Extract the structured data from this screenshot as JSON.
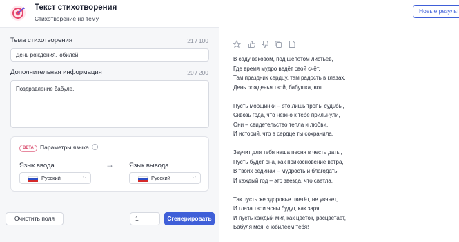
{
  "header": {
    "title": "Текст стихотворения",
    "subtitle": "Стихотворение на тему"
  },
  "topic": {
    "label": "Тема стихотворения",
    "counter": "21 / 100",
    "value": "День рождения, юбилей"
  },
  "extra": {
    "label": "Дополнительная информация",
    "counter": "20 / 200",
    "value": "Поздравление бабуле,"
  },
  "language": {
    "beta": "BETA",
    "title": "Параметры языка",
    "info": "i",
    "input_label": "Язык ввода",
    "output_label": "Язык вывода",
    "input_value": "Русский",
    "output_value": "Русский",
    "arrow": "→",
    "chevron": "⌵"
  },
  "footer": {
    "clear_label": "Очистить поля",
    "quantity": "1",
    "generate_label": "Сгенерировать"
  },
  "result": {
    "new_results_label": "Новые результаты",
    "actions": [
      "star-icon",
      "thumbs-up-icon",
      "thumbs-down-icon",
      "copy-icon",
      "document-icon"
    ],
    "stanzas": [
      [
        "В саду вековом, под шёпотом листьев,",
        "Где время мудро ведёт свой счёт,",
        "Там праздник сердцу, там радость в глазах,",
        "День рожденья твой, бабушка, вот."
      ],
      [
        "Пусть морщинки – это лишь тропы судьбы,",
        "Сквозь года, что нежно к тебе прильнули,",
        "Они – свидетельство тепла и любви,",
        "И историй, что в сердце ты сохранила."
      ],
      [
        "Звучит для тебя наша песня в честь даты,",
        "Пусть будет она, как прикосновение ветра,",
        "В твоих сединах – мудрость и благодать,",
        "И каждый год – это звезда, что светла."
      ],
      [
        "Так пусть же здоровье цветёт, не увянет,",
        "И глаза твои ясны будут, как заря,",
        "И пусть каждый миг, как цветок, расцветает,",
        "Бабуля моя, с юбилеем тебя!"
      ]
    ]
  },
  "colors": {
    "accent": "#3f5fd8",
    "brand": "#e8476b"
  }
}
